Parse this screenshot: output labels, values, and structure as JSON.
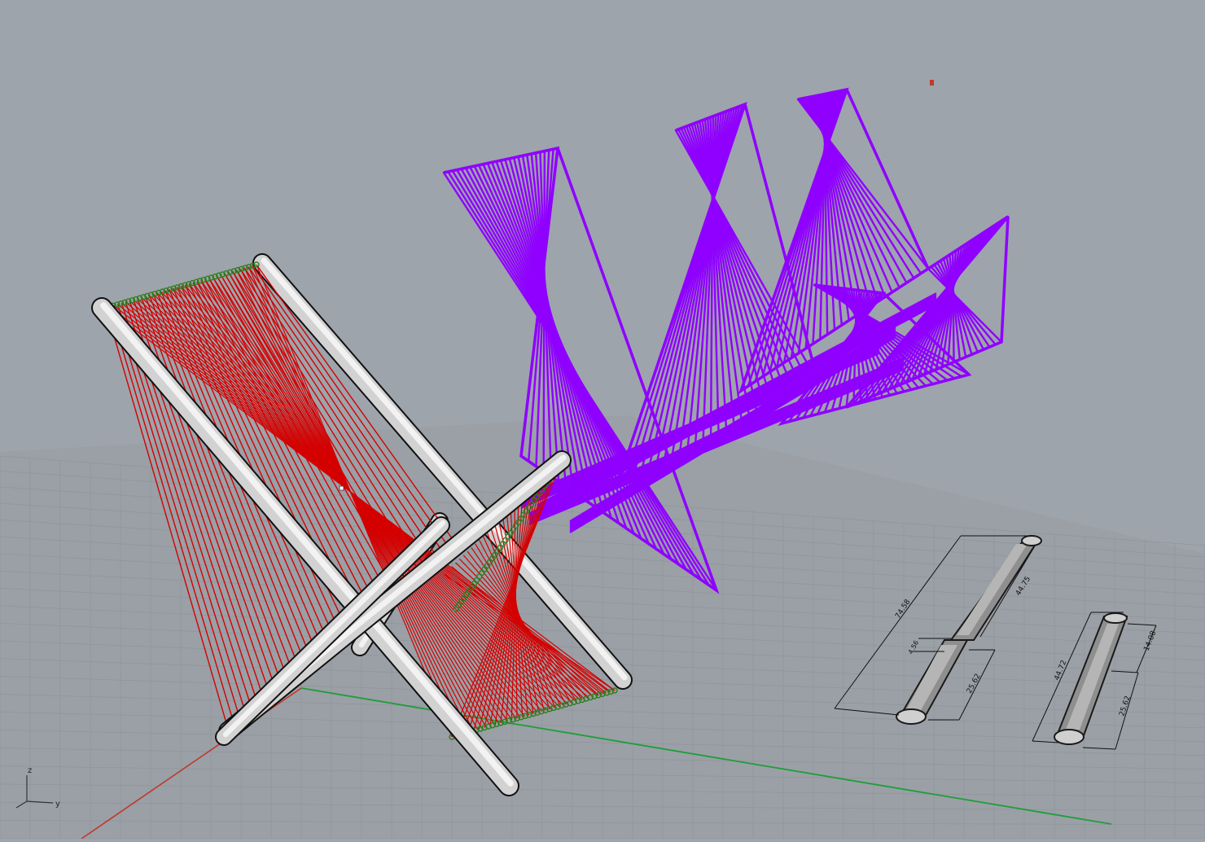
{
  "viewport": {
    "background": "#9ea4ab",
    "grid_color": "#8d9299",
    "x_axis_color": "#c0392b",
    "y_axis_color": "#1e9e3a"
  },
  "axes_widget": {
    "z_label": "z",
    "y_label": "y"
  },
  "objects": {
    "chair_strings_color": "#d40000",
    "knot_color": "#2e7d1f",
    "frame_fill": "#d2d2d2",
    "wave_structure_color": "#8f00ff"
  },
  "dimensions": {
    "part_a": {
      "overall": "74.58",
      "upper": "44.75",
      "joint": "4.56",
      "lower": "25.62"
    },
    "part_b": {
      "overall": "44.72",
      "upper": "14.08",
      "lower": "25.62"
    }
  }
}
